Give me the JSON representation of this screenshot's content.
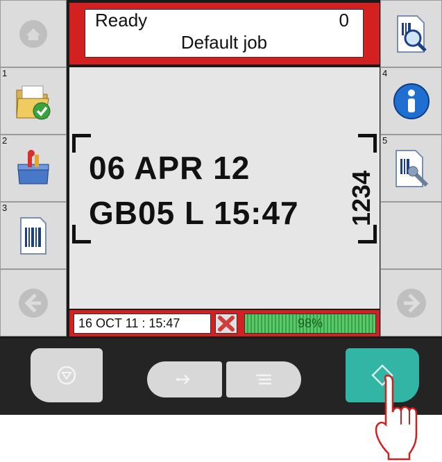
{
  "status": {
    "state": "Ready",
    "count": "0",
    "job": "Default job"
  },
  "message": {
    "line1": "06 APR 12",
    "line2": "GB05 L 15:47",
    "vertical": "1234"
  },
  "bottom": {
    "datetime": "16 OCT 11 : 15:47",
    "ink_level": "98%"
  },
  "sidebar_left": [
    {
      "num": "",
      "icon": "home-icon"
    },
    {
      "num": "1",
      "icon": "folder-check-icon"
    },
    {
      "num": "2",
      "icon": "toolbox-icon"
    },
    {
      "num": "3",
      "icon": "barcode-document-icon"
    },
    {
      "num": "",
      "icon": "arrow-left-icon"
    }
  ],
  "sidebar_right": [
    {
      "num": "",
      "icon": "search-document-icon"
    },
    {
      "num": "4",
      "icon": "info-icon"
    },
    {
      "num": "5",
      "icon": "settings-document-icon"
    },
    {
      "num": "",
      "icon": "empty"
    },
    {
      "num": "",
      "icon": "arrow-right-icon"
    }
  ],
  "colors": {
    "frame_red": "#d32121",
    "accent_green": "#33b5a5",
    "ink_green": "#37a349"
  },
  "hardware_keys": [
    "stop-icon",
    "login-icon",
    "menu-list-icon",
    "start-icon"
  ]
}
